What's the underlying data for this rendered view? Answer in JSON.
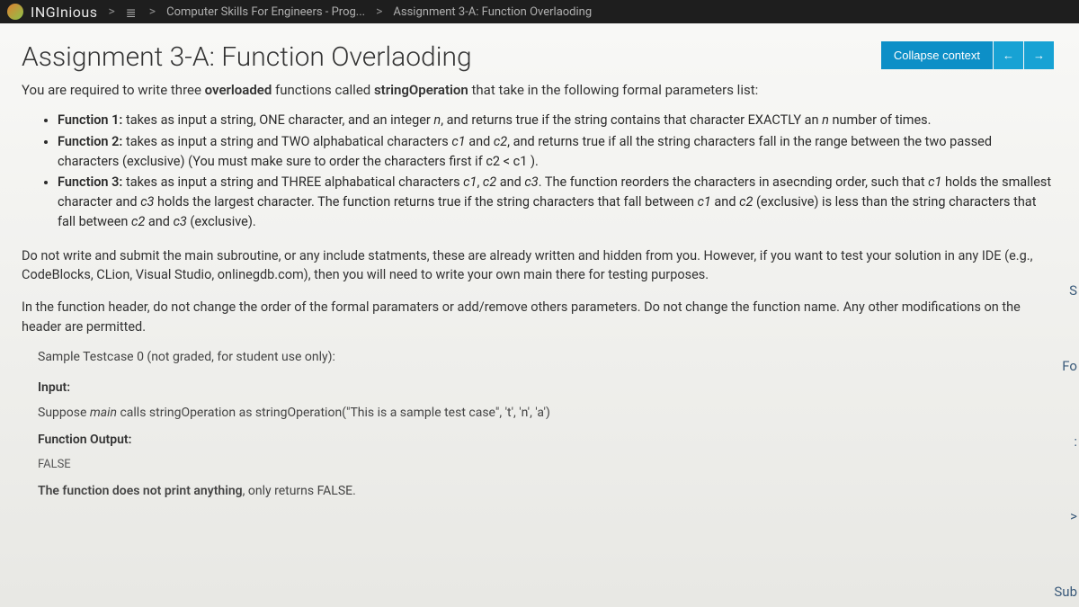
{
  "breadcrumb": {
    "brand": "INGInious",
    "course": "Computer Skills For Engineers - Prog...",
    "page": "Assignment 3-A: Function Overlaoding"
  },
  "header": {
    "title": "Assignment 3-A: Function Overlaoding",
    "collapse_label": "Collapse context",
    "prev_arrow": "←",
    "next_arrow": "→"
  },
  "intro": {
    "prefix": "You are required to write three ",
    "bold1": "overloaded",
    "mid": " functions called ",
    "bold2": "stringOperation",
    "suffix": " that take in the following formal parameters list:"
  },
  "functions": [
    {
      "label": "Function 1:",
      "body_pre": " takes as input a string, ONE character, and an integer ",
      "em1": "n",
      "body_mid": ", and returns true if the string contains that character EXACTLY an ",
      "em2": "n",
      "body_post": " number of times."
    },
    {
      "label": "Function 2:",
      "body_pre": " takes as input a string and TWO alphabatical characters ",
      "em1": "c1",
      "body_mid1": " and ",
      "em2": "c2",
      "body_post": ", and returns true if all the string characters fall in the range between the two passed characters (exclusive) (You must make sure to order the characters first if c2 < c1 )."
    },
    {
      "label": "Function 3:",
      "body_pre": " takes as input a string and THREE alphabatical characters ",
      "em1": "c1",
      "body_mid1": ", ",
      "em2": "c2",
      "body_mid2": " and ",
      "em3": "c3",
      "body_mid3": ". The function reorders the characters in asecnding order, such that ",
      "em4": "c1",
      "body_mid4": " holds the smallest character and ",
      "em5": "c3",
      "body_mid5": " holds the largest character. The function returns true if the string characters that fall between ",
      "em6": "c1",
      "body_mid6": " and ",
      "em7": "c2",
      "body_mid7": " (exclusive) is less than the string characters that fall between ",
      "em8": "c2",
      "body_mid8": " and ",
      "em9": "c3",
      "body_post": " (exclusive)."
    }
  ],
  "note1": "Do not write and submit the main subroutine, or any include statments, these are already written and hidden from you. However, if you want to test your solution in any IDE (e.g., CodeBlocks, CLion, Visual Studio, onlinegdb.com), then you will need to write your own main there for testing purposes.",
  "note2": "In the function header, do not change the order of the formal paramaters or add/remove others parameters. Do not change the function name. Any other modifications on the header are permitted.",
  "sample": {
    "title": "Sample Testcase 0 (not graded, for student use only):",
    "input_label": "Input:",
    "input_pre": "Suppose ",
    "input_em": "main",
    "input_post": " calls stringOperation as stringOperation(\"This is a sample test case\", 't', 'n', 'a')",
    "output_label": "Function Output:",
    "output_value": "FALSE",
    "output_note_pre": "The function does not print anything",
    "output_note_post": ", only returns FALSE."
  },
  "right_edge": {
    "s": "S",
    "fo": "Fo",
    "colon": ":",
    "angle": ">",
    "sub": "Sub"
  }
}
